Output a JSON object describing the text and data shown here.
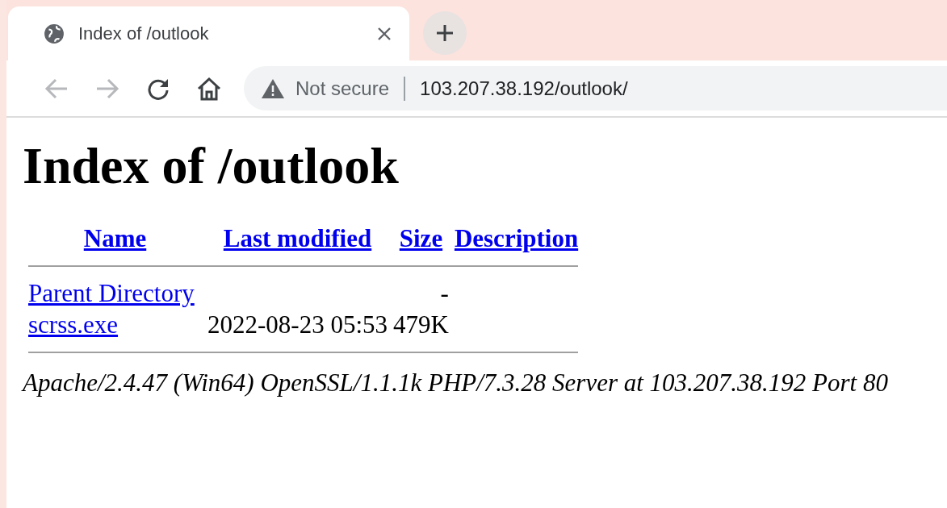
{
  "tab": {
    "title": "Index of /outlook",
    "selected": true
  },
  "toolbar": {
    "security": "Not secure",
    "url": "103.207.38.192/outlook/"
  },
  "page": {
    "heading": "Index of /outlook",
    "columns": [
      "Name",
      "Last modified",
      "Size",
      "Description"
    ],
    "rows": [
      {
        "name": "Parent Directory",
        "size": "-"
      },
      {
        "name": "scrss.exe",
        "last_modified": "2022-08-23 05:53",
        "size": "479K"
      }
    ],
    "footer": "Apache/2.4.47 (Win64) OpenSSL/1.1.1k PHP/7.3.28 Server at 103.207.38.192 Port 80"
  }
}
